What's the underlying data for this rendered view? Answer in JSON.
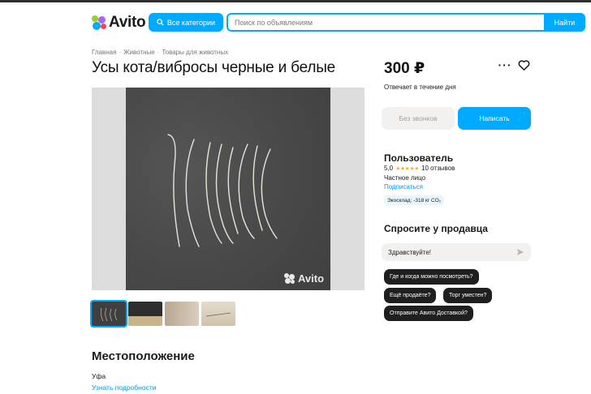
{
  "header": {
    "logo_text": "Avito",
    "categories_button": "Все категории",
    "search_placeholder": "Поиск по объявлениям",
    "search_button": "Найти"
  },
  "breadcrumbs": [
    "Главная",
    "Животные",
    "Товары для животных"
  ],
  "listing": {
    "title": "Усы кота/вибросы черные и белые",
    "price": "300 ₽",
    "reply_note": "Отвечает в течение дня",
    "no_calls_button": "Без звонков",
    "write_button": "Написать",
    "photo_watermark": "Avito",
    "thumbnail_count": 4
  },
  "seller": {
    "name": "Пользователь",
    "rating_value": "5,0",
    "stars": "★★★★★",
    "reviews": "10 отзывов",
    "type": "Частное лицо",
    "subscribe_link": "Подписаться",
    "eco_badge": "Экосклад: -318 кг CO₂"
  },
  "ask_seller": {
    "title": "Спросите у продавца",
    "message_value": "Здравствуйте!",
    "quick_questions": [
      "Где и когда можно посмотреть?",
      "Ещё продаёте?",
      "Торг уместен?",
      "Отправите Авито Доставкой?"
    ]
  },
  "location": {
    "title": "Местоположение",
    "city": "Уфа",
    "details_link": "Узнать подробности"
  },
  "colors": {
    "accent": "#00aaff",
    "link": "#0099f7",
    "chip_bg": "#1f1f1f",
    "star": "#ffb021"
  },
  "icons": [
    "search-icon",
    "more-icon",
    "heart-icon",
    "send-icon"
  ]
}
